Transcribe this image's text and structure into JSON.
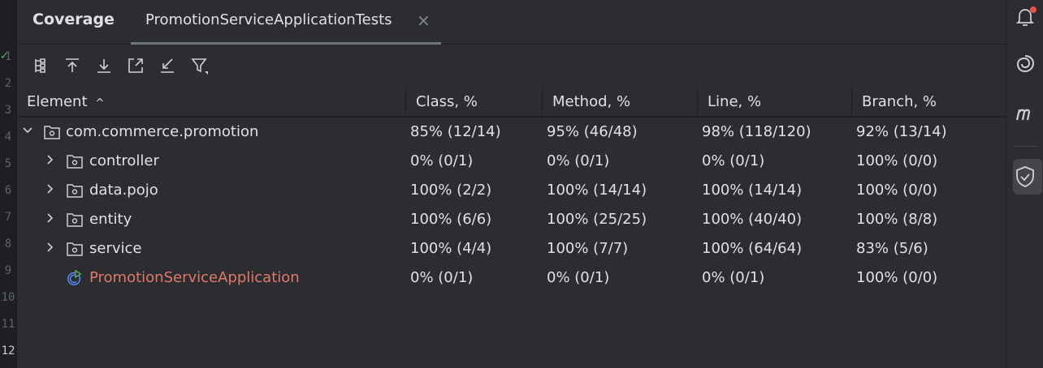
{
  "gutter": {
    "line_numbers": [
      "1",
      "2",
      "3",
      "4",
      "5",
      "6",
      "7",
      "8",
      "9",
      "10",
      "11",
      "12"
    ]
  },
  "tool_window": {
    "title": "Coverage",
    "tab": {
      "label": "PromotionServiceApplicationTests",
      "close_glyph": "×"
    }
  },
  "toolbar": {
    "buttons": [
      "flatten-packages-icon",
      "collapse-up-icon",
      "expand-down-icon",
      "export-icon",
      "import-icon",
      "filter-icon"
    ]
  },
  "table": {
    "columns": [
      "Element",
      "Class, %",
      "Method, %",
      "Line, %",
      "Branch, %"
    ],
    "sort_glyph": "^",
    "rows": [
      {
        "name": "com.commerce.promotion",
        "class": "85% (12/14)",
        "method": "95% (46/48)",
        "line": "98% (118/120)",
        "branch": "92% (13/14)",
        "expanded": true
      },
      {
        "name": "controller",
        "class": "0% (0/1)",
        "method": "0% (0/1)",
        "line": "0% (0/1)",
        "branch": "100% (0/0)"
      },
      {
        "name": "data.pojo",
        "class": "100% (2/2)",
        "method": "100% (14/14)",
        "line": "100% (14/14)",
        "branch": "100% (0/0)"
      },
      {
        "name": "entity",
        "class": "100% (6/6)",
        "method": "100% (25/25)",
        "line": "100% (40/40)",
        "branch": "100% (8/8)"
      },
      {
        "name": "service",
        "class": "100% (4/4)",
        "method": "100% (7/7)",
        "line": "100% (64/64)",
        "branch": "83% (5/6)"
      },
      {
        "name": "PromotionServiceApplication",
        "class": "0% (0/1)",
        "method": "0% (0/1)",
        "line": "0% (0/1)",
        "branch": "100% (0/0)"
      }
    ]
  },
  "colors": {
    "accent_app": "#e0796a",
    "notification_dot": "#e5534b",
    "check": "#5fb865"
  }
}
